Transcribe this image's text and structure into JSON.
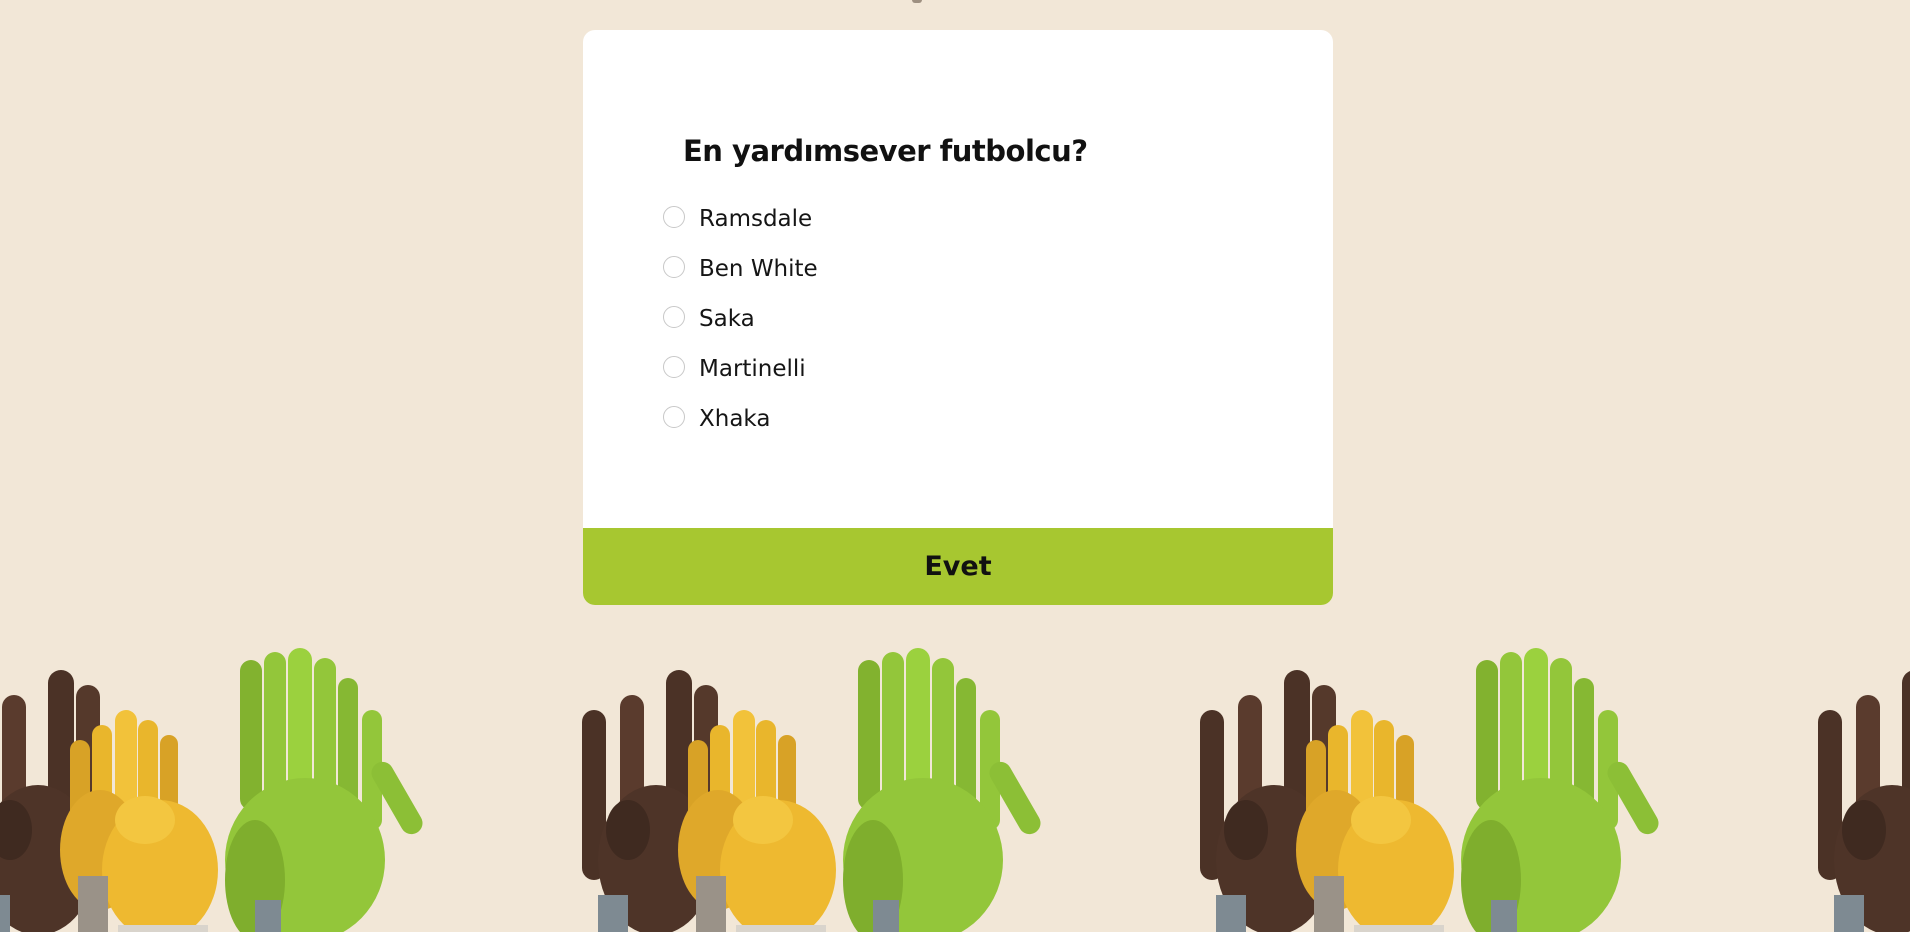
{
  "poll": {
    "question": "En yardımsever futbolcu?",
    "options": [
      {
        "label": "Ramsdale",
        "selected": false
      },
      {
        "label": "Ben White",
        "selected": false
      },
      {
        "label": "Saka",
        "selected": false
      },
      {
        "label": "Martinelli",
        "selected": false
      },
      {
        "label": "Xhaka",
        "selected": false
      }
    ],
    "submit_label": "Evet"
  },
  "decoration": {
    "icon": "raised-hands-illustration",
    "colors": {
      "brown": "#4b3226",
      "yellow": "#e9b62c",
      "green": "#93c63a"
    }
  },
  "colors": {
    "background": "#f2e7d7",
    "card": "#ffffff",
    "accent": "#a7c730"
  }
}
